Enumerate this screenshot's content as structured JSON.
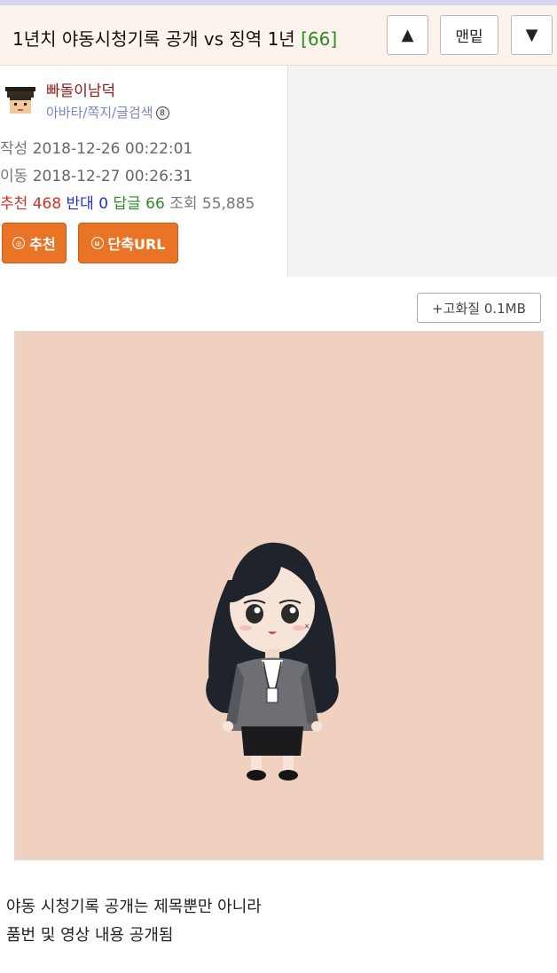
{
  "header": {
    "title": "1년치 야동시청기록 공개 vs 징역 1년",
    "comment_count": "[66]",
    "up_label": "▲",
    "bottom_label": "맨밑",
    "down_label": "▼"
  },
  "author": {
    "nickname": "빠돌이남덕",
    "links": "아바타/쪽지/글검색",
    "badge_icon": "level-badge-icon"
  },
  "meta": {
    "written_label": "작성",
    "written_value": "2018-12-26 00:22:01",
    "moved_label": "이동",
    "moved_value": "2018-12-27 00:26:31"
  },
  "stats": {
    "recommend_label": "추천",
    "recommend_value": "468",
    "oppose_label": "반대",
    "oppose_value": "0",
    "reply_label": "답글",
    "reply_value": "66",
    "views_label": "조회",
    "views_value": "55,885"
  },
  "actions": {
    "recommend_button": "추천",
    "shorturl_button": "단축URL"
  },
  "media": {
    "hq_button": "+고화질 0.1MB"
  },
  "content": {
    "line1": "야동 시청기록 공개는 제목뿐만 아니라",
    "line2": "품번 및 영상 내용 공개됨"
  },
  "colors": {
    "title_bg": "#fcf3ec",
    "accent_orange": "#ea7425",
    "comment_count_green": "#2e8b22",
    "recommend_red": "#d6302a",
    "oppose_blue": "#1f2fd6",
    "image_bg": "#f0d1c0"
  }
}
